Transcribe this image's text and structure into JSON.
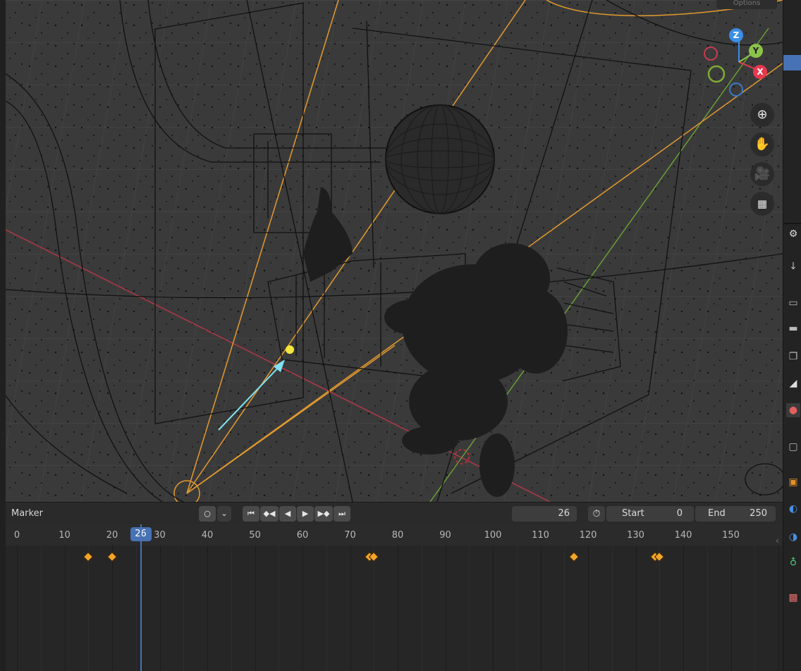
{
  "viewport": {
    "options_label": "Options",
    "gizmo": {
      "z": "Z",
      "y": "Y",
      "x": "X"
    },
    "nav_icons": [
      "zoom-icon",
      "pan-hand-icon",
      "camera-view-icon",
      "orthographic-grid-icon"
    ]
  },
  "timeline": {
    "marker_label": "Marker",
    "record_icon": "record-circle-icon",
    "playback_buttons": [
      "jump-to-start-icon",
      "prev-keyframe-icon",
      "play-reverse-icon",
      "play-icon",
      "next-keyframe-icon",
      "jump-to-end-icon"
    ],
    "current_frame": "26",
    "start_label": "Start",
    "start_value": "0",
    "end_label": "End",
    "end_value": "250",
    "ruler_ticks": [
      "0",
      "10",
      "20",
      "30",
      "40",
      "50",
      "60",
      "70",
      "80",
      "90",
      "100",
      "110",
      "120",
      "130",
      "140",
      "150"
    ],
    "keyframes": [
      15,
      20,
      74,
      75,
      117,
      134,
      135
    ]
  },
  "colors": {
    "accent": "#4772b3",
    "keyframe": "#f2a52c",
    "axis_x": "#e8384f",
    "axis_y": "#8bc34a",
    "axis_z": "#3a8ee6"
  }
}
